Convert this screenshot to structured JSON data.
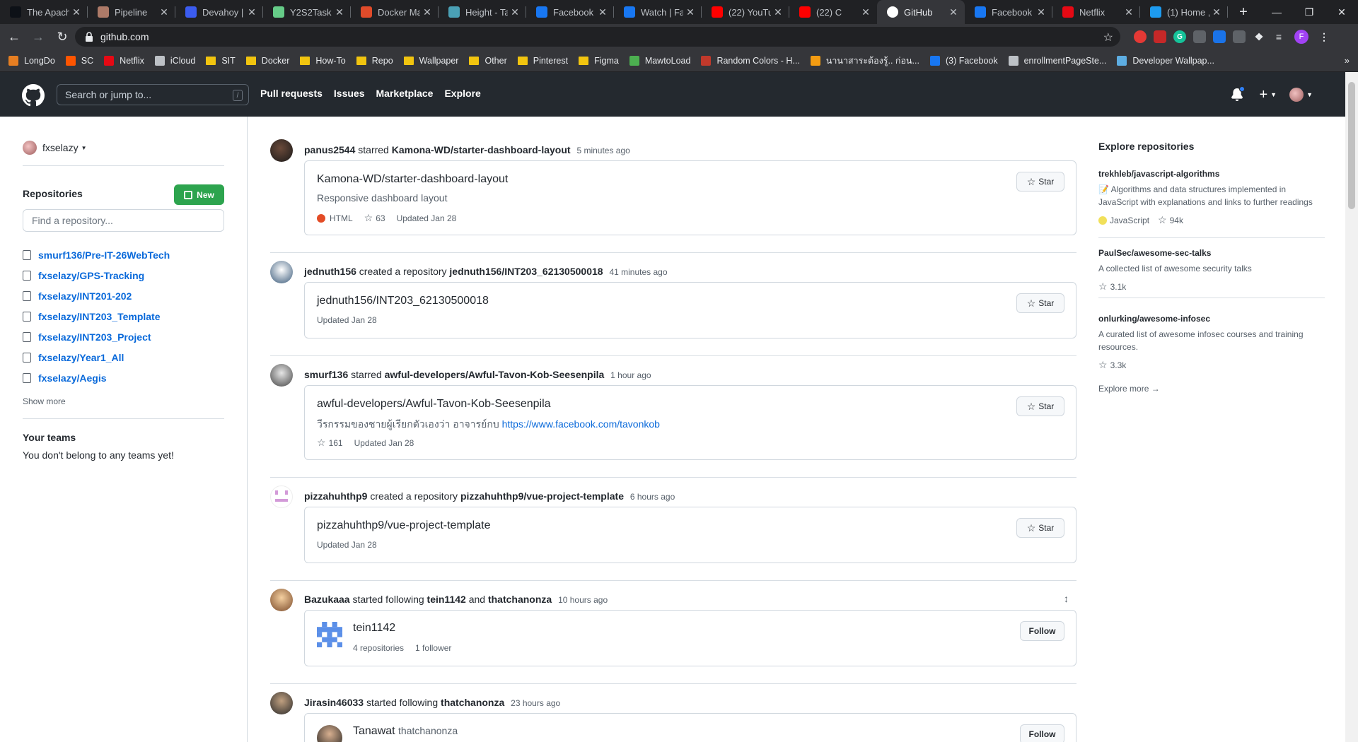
{
  "browser": {
    "tabs": [
      {
        "title": "The Apach",
        "icon": "github-icon",
        "color": "#0d1117"
      },
      {
        "title": "Pipeline",
        "icon": "pipeline-icon",
        "color": "#ad7a68"
      },
      {
        "title": "Devahoy |",
        "icon": "devahoy-icon",
        "color": "#3b5cf0"
      },
      {
        "title": "Y2S2Task |",
        "icon": "checkmark-icon",
        "color": "#6c8"
      },
      {
        "title": "Docker Ma",
        "icon": "udemy-icon",
        "color": "#e04b2a"
      },
      {
        "title": "Height - Ta",
        "icon": "wave-icon",
        "color": "#4aa0b5"
      },
      {
        "title": "Facebook",
        "icon": "facebook-icon",
        "color": "#1877f2"
      },
      {
        "title": "Watch | Fa",
        "icon": "facebook-icon",
        "color": "#1877f2"
      },
      {
        "title": "(22) YouTu",
        "icon": "youtube-icon",
        "color": "#ff0000"
      },
      {
        "title": "(22) C",
        "icon": "youtube-icon",
        "color": "#ff0000"
      },
      {
        "title": "GitHub",
        "icon": "github-icon",
        "color": "#ffffff"
      },
      {
        "title": "Facebook",
        "icon": "facebook-icon",
        "color": "#1877f2"
      },
      {
        "title": "Netflix",
        "icon": "netflix-icon",
        "color": "#e50914"
      },
      {
        "title": "(1) Home ,",
        "icon": "twitter-icon",
        "color": "#1d9bf0"
      }
    ],
    "url": "github.com",
    "bookmarks": [
      {
        "label": "LongDo",
        "icon": "longdo-icon",
        "color": "#e67e22"
      },
      {
        "label": "SC",
        "icon": "soundcloud-icon",
        "color": "#ff5500"
      },
      {
        "label": "Netflix",
        "icon": "netflix-icon",
        "color": "#e50914"
      },
      {
        "label": "iCloud",
        "icon": "apple-icon",
        "color": "#bdc1c6"
      },
      {
        "label": "SIT",
        "icon": "folder-icon",
        "color": "#f1c40f"
      },
      {
        "label": "Docker",
        "icon": "folder-icon",
        "color": "#f1c40f"
      },
      {
        "label": "How-To",
        "icon": "folder-icon",
        "color": "#f1c40f"
      },
      {
        "label": "Repo",
        "icon": "folder-icon",
        "color": "#f1c40f"
      },
      {
        "label": "Wallpaper",
        "icon": "folder-icon",
        "color": "#f1c40f"
      },
      {
        "label": "Other",
        "icon": "folder-icon",
        "color": "#f1c40f"
      },
      {
        "label": "Pinterest",
        "icon": "folder-icon",
        "color": "#f1c40f"
      },
      {
        "label": "Figma",
        "icon": "folder-icon",
        "color": "#f1c40f"
      },
      {
        "label": "MawtoLoad",
        "icon": "mawtoload-icon",
        "color": "#4caf50"
      },
      {
        "label": "Random Colors - H...",
        "icon": "colors-icon",
        "color": "#c0392b"
      },
      {
        "label": "นานาสาระต้องรู้.. ก่อน...",
        "icon": "thai-site-icon",
        "color": "#f39c12"
      },
      {
        "label": "(3) Facebook",
        "icon": "facebook-icon",
        "color": "#1877f2"
      },
      {
        "label": "enrollmentPageSte...",
        "icon": "globe-icon",
        "color": "#bdc1c6"
      },
      {
        "label": "Developer Wallpap...",
        "icon": "wallpaper-icon",
        "color": "#5dade2"
      }
    ],
    "bookmarks_more": "»"
  },
  "gh_header": {
    "search_placeholder": "Search or jump to...",
    "search_key": "/",
    "nav": [
      "Pull requests",
      "Issues",
      "Marketplace",
      "Explore"
    ]
  },
  "sidebar": {
    "username": "fxselazy",
    "repos_heading": "Repositories",
    "new_button": "New",
    "find_placeholder": "Find a repository...",
    "repos": [
      "smurf136/Pre-IT-26WebTech",
      "fxselazy/GPS-Tracking",
      "fxselazy/INT201-202",
      "fxselazy/INT203_Template",
      "fxselazy/INT203_Project",
      "fxselazy/Year1_All",
      "fxselazy/Aegis"
    ],
    "show_more": "Show more",
    "teams_heading": "Your teams",
    "teams_text": "You don't belong to any teams yet!"
  },
  "feed": [
    {
      "actor": "panus2544",
      "action": "starred",
      "target": "Kamona-WD/starter-dashboard-layout",
      "time": "5 minutes ago",
      "card": {
        "name": "Kamona-WD/starter-dashboard-layout",
        "description": "Responsive dashboard layout",
        "language": "HTML",
        "lang_color": "#e34c26",
        "stars": "63",
        "updated": "Updated Jan 28",
        "button": "Star"
      }
    },
    {
      "actor": "jednuth156",
      "action": "created a repository",
      "target": "jednuth156/INT203_62130500018",
      "time": "41 minutes ago",
      "card": {
        "name": "jednuth156/INT203_62130500018",
        "updated": "Updated Jan 28",
        "button": "Star"
      }
    },
    {
      "actor": "smurf136",
      "action": "starred",
      "target": "awful-developers/Awful-Tavon-Kob-Seesenpila",
      "time": "1 hour ago",
      "card": {
        "name": "awful-developers/Awful-Tavon-Kob-Seesenpila",
        "description": "วีรกรรมของชายผู้เรียกตัวเองว่า อาจารย์กบ ",
        "link": "https://www.facebook.com/tavonkob",
        "stars": "161",
        "updated": "Updated Jan 28",
        "button": "Star"
      }
    },
    {
      "actor": "pizzahuhthp9",
      "action": "created a repository",
      "target": "pizzahuhthp9/vue-project-template",
      "time": "6 hours ago",
      "card": {
        "name": "pizzahuhthp9/vue-project-template",
        "updated": "Updated Jan 28",
        "button": "Star"
      }
    },
    {
      "actor": "Bazukaaa",
      "action": "started following",
      "target": "tein1142",
      "and": "and",
      "target2": "thatchanonza",
      "time": "10 hours ago",
      "card": {
        "name": "tein1142",
        "repos": "4 repositories",
        "followers": "1 follower",
        "button": "Follow"
      }
    },
    {
      "actor": "Jirasin46033",
      "action": "started following",
      "target": "thatchanonza",
      "time": "23 hours ago",
      "card": {
        "name": "Tanawat",
        "login": "thatchanonza",
        "button": "Follow"
      }
    }
  ],
  "explore": {
    "heading": "Explore repositories",
    "repos": [
      {
        "name": "trekhleb/javascript-algorithms",
        "description": "📝 Algorithms and data structures implemented in JavaScript with explanations and links to further readings",
        "language": "JavaScript",
        "lang_color": "#f1e05a",
        "stars": "94k"
      },
      {
        "name": "PaulSec/awesome-sec-talks",
        "description": "A collected list of awesome security talks",
        "stars": "3.1k"
      },
      {
        "name": "onlurking/awesome-infosec",
        "description": "A curated list of awesome infosec courses and training resources.",
        "stars": "3.3k"
      }
    ],
    "more": "Explore more →"
  }
}
